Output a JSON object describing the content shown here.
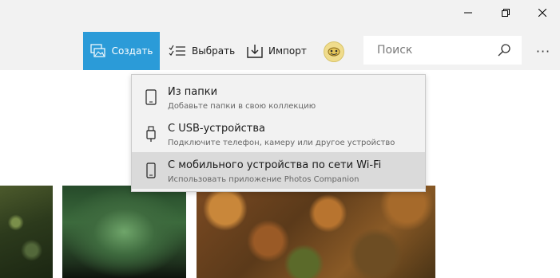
{
  "window_controls": {
    "minimize": "minimize-icon",
    "maximize": "restore-icon",
    "close": "close-icon"
  },
  "toolbar": {
    "create_label": "Создать",
    "select_label": "Выбрать",
    "import_label": "Импорт",
    "search_placeholder": "Поиск",
    "more_label": "···"
  },
  "import_menu": {
    "items": [
      {
        "title": "Из папки",
        "subtitle": "Добавьте папки в свою коллекцию",
        "icon": "tablet-icon",
        "highlighted": false
      },
      {
        "title": "С USB-устройства",
        "subtitle": "Подключите телефон, камеру или другое устройство",
        "icon": "usb-icon",
        "highlighted": false
      },
      {
        "title": "С мобильного устройства по сети Wi-Fi",
        "subtitle": "Использовать приложение Photos Companion",
        "icon": "phone-icon",
        "highlighted": true
      }
    ]
  },
  "colors": {
    "accent": "#2b9bd8",
    "bar_background": "#f2f2f2",
    "menu_highlight": "#dadada"
  }
}
